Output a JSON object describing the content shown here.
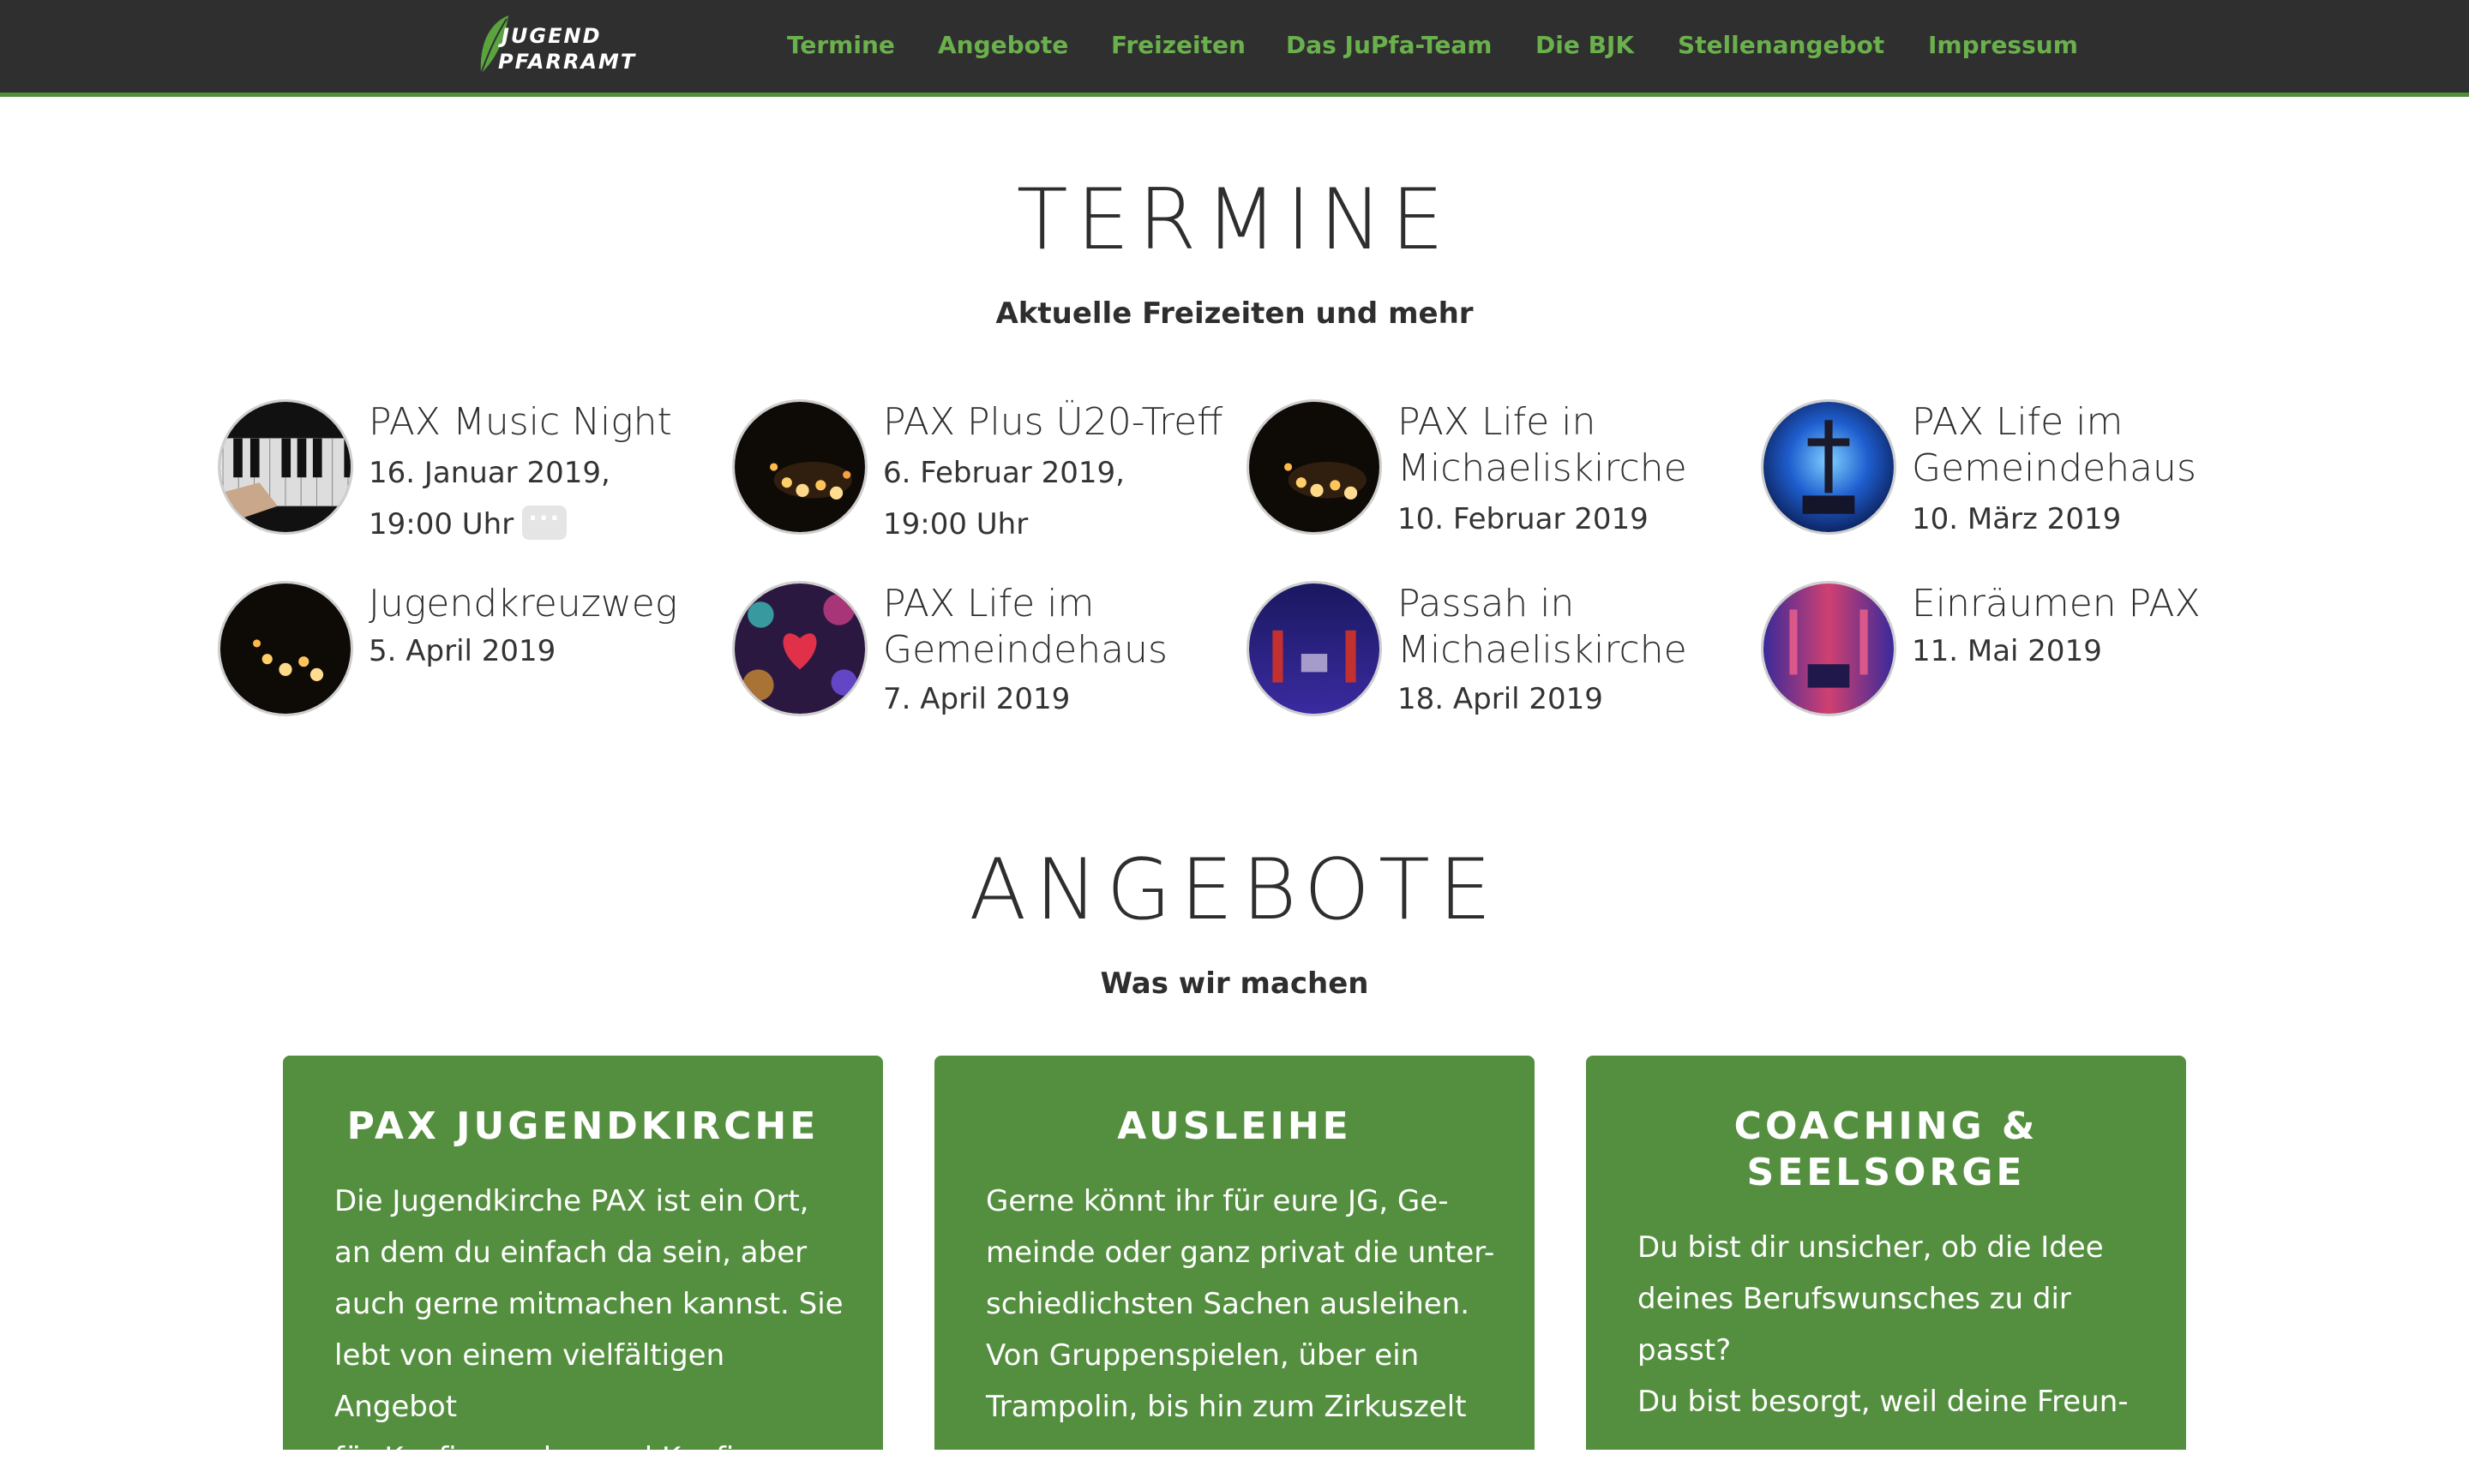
{
  "nav": {
    "logo_line1": "JUGEND",
    "logo_line2": "PFARRAMT",
    "items": [
      {
        "label": "Termine"
      },
      {
        "label": "Angebote"
      },
      {
        "label": "Freizeiten"
      },
      {
        "label": "Das JuPfa-Team"
      },
      {
        "label": "Die BJK"
      },
      {
        "label": "Stellenangebot"
      },
      {
        "label": "Impressum"
      }
    ]
  },
  "termine": {
    "heading": "TERMINE",
    "subheading": "Aktuelle Freizeiten und mehr",
    "events": [
      {
        "title": "PAX Music Night",
        "date": "16. Januar 2019,",
        "time": "19:00 Uhr",
        "image": "piano-keys"
      },
      {
        "title": "PAX Plus Ü20-Treff",
        "date": "6. Februar 2019,",
        "time": "19:00 Uhr",
        "image": "candles"
      },
      {
        "title": "PAX Life in Michaeliskirche",
        "date": "10. Februar 2019",
        "image": "candles"
      },
      {
        "title": "PAX Life im Gemeindehaus",
        "date": "10. März 2019",
        "image": "church-cross-blue"
      },
      {
        "title": "Jugendkreuzweg",
        "date": "5. April 2019",
        "image": "candles"
      },
      {
        "title": "PAX Life im Gemeindehaus",
        "date": "7. April 2019",
        "image": "heart-bokeh"
      },
      {
        "title": "Passah in Michaeliskirche",
        "date": "18. April 2019",
        "image": "church-night"
      },
      {
        "title": "Einräumen PAX",
        "date": "11. Mai 2019",
        "image": "church-lights"
      }
    ],
    "more_label": "···"
  },
  "angebote": {
    "heading": "ANGEBOTE",
    "subheading": "Was wir machen",
    "cards": [
      {
        "title": "PAX JUGENDKIRCHE",
        "body": "Die Jugendkirche PAX ist ein Ort,\nan dem du einfach da sein, aber\nauch gerne mitmachen kannst. Sie\nlebt von einem vielfältigen Angebot\nfür Konfirmanden und Konfirman-"
      },
      {
        "title": "AUSLEIHE",
        "body": "Gerne könnt ihr für eure JG, Ge-\nmeinde oder ganz privat die unter-\nschiedlichsten Sachen ausleihen.\nVon Gruppenspielen, über ein\nTrampolin, bis hin zum Zirkuszelt"
      },
      {
        "title": "COACHING &\nSEELSORGE",
        "body": "Du bist dir unsicher, ob die Idee\ndeines Berufswunsches zu dir\npasst?\nDu bist besorgt, weil deine Freun-"
      }
    ]
  },
  "colors": {
    "nav_bg": "#2f2f2f",
    "accent": "#6ab04c",
    "card_bg": "#548f3f"
  }
}
